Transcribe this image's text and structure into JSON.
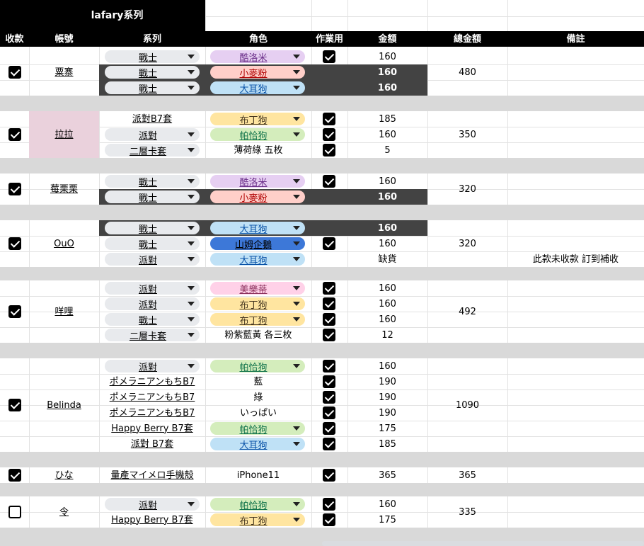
{
  "sheet": {
    "title": "lafary系列",
    "headers": {
      "paid": "收款",
      "account": "帳號",
      "series": "系列",
      "role": "角色",
      "work": "作業用",
      "amount": "金額",
      "total": "總金額",
      "note": "備註"
    },
    "colors": {
      "header_bg": "#000000",
      "separator": "#d9d9d9",
      "dark_row": "#434343",
      "pink_cell": "#ead1dc",
      "chip_grey": "#e8eaed",
      "chip_purple": "#e6cff2",
      "chip_red": "#ffcfc9",
      "chip_blue": "#bfe1f6",
      "chip_yellow": "#ffe5a0",
      "chip_green": "#d4edbc",
      "chip_pink": "#ffd1e8",
      "chip_royal": "#3d78d8"
    },
    "groups": [
      {
        "account": "粟寨",
        "paid": true,
        "total": "480",
        "account_bg": "",
        "rows": [
          {
            "series": "戰士",
            "series_chip": true,
            "role": "酷洛米",
            "role_color": "purple",
            "work": true,
            "amount": "160",
            "dark": false,
            "note": ""
          },
          {
            "series": "戰士",
            "series_chip": true,
            "role": "小麥粉",
            "role_color": "red",
            "work": false,
            "amount": "160",
            "dark": true,
            "note": ""
          },
          {
            "series": "戰士",
            "series_chip": true,
            "role": "大耳狗",
            "role_color": "blue",
            "work": false,
            "amount": "160",
            "dark": true,
            "note": ""
          }
        ]
      },
      {
        "account": "拉拉",
        "paid": true,
        "total": "350",
        "account_bg": "pink",
        "rows": [
          {
            "series": "派對B7套",
            "series_chip": false,
            "role": "布丁狗",
            "role_color": "yellow",
            "work": true,
            "amount": "185",
            "dark": false,
            "note": ""
          },
          {
            "series": "派對",
            "series_chip": true,
            "role": "帕恰狗",
            "role_color": "green",
            "work": true,
            "amount": "160",
            "dark": false,
            "note": ""
          },
          {
            "series": "二層卡套",
            "series_chip": true,
            "role": "薄荷綠 五枚",
            "role_color": "",
            "work": true,
            "amount": "5",
            "dark": false,
            "note": ""
          }
        ]
      },
      {
        "account": "莓栗栗",
        "paid": true,
        "total": "320",
        "account_bg": "",
        "rows": [
          {
            "series": "戰士",
            "series_chip": true,
            "role": "酷洛米",
            "role_color": "purple",
            "work": true,
            "amount": "160",
            "dark": false,
            "note": ""
          },
          {
            "series": "戰士",
            "series_chip": true,
            "role": "小麥粉",
            "role_color": "red",
            "work": false,
            "amount": "160",
            "dark": true,
            "note": ""
          }
        ]
      },
      {
        "account": "OuO",
        "paid": true,
        "total": "320",
        "account_bg": "",
        "rows": [
          {
            "series": "戰士",
            "series_chip": true,
            "role": "大耳狗",
            "role_color": "blue",
            "work": false,
            "amount": "160",
            "dark": true,
            "note": ""
          },
          {
            "series": "戰士",
            "series_chip": true,
            "role": "山姆企鵝",
            "role_color": "royal",
            "work": true,
            "amount": "160",
            "dark": false,
            "note": ""
          },
          {
            "series": "派對",
            "series_chip": true,
            "role": "大耳狗",
            "role_color": "blue",
            "work": false,
            "amount": "缺貨",
            "dark": false,
            "note": "此款未收款 訂到補收"
          }
        ]
      },
      {
        "account": "咩哩",
        "paid": true,
        "total": "492",
        "account_bg": "",
        "rows": [
          {
            "series": "派對",
            "series_chip": true,
            "role": "美樂蒂",
            "role_color": "pink",
            "work": true,
            "amount": "160",
            "dark": false,
            "note": ""
          },
          {
            "series": "派對",
            "series_chip": true,
            "role": "布丁狗",
            "role_color": "yellow",
            "work": true,
            "amount": "160",
            "dark": false,
            "note": ""
          },
          {
            "series": "戰士",
            "series_chip": true,
            "role": "布丁狗",
            "role_color": "yellow",
            "work": true,
            "amount": "160",
            "dark": false,
            "note": ""
          },
          {
            "series": "二層卡套",
            "series_chip": true,
            "role": "粉紫藍黃 各三枚",
            "role_color": "",
            "work": true,
            "amount": "12",
            "dark": false,
            "note": ""
          }
        ]
      },
      {
        "account": "Belinda",
        "paid": true,
        "total": "1090",
        "account_bg": "",
        "rows": [
          {
            "series": "派對",
            "series_chip": true,
            "role": "帕恰狗",
            "role_color": "green",
            "work": true,
            "amount": "160",
            "dark": false,
            "note": ""
          },
          {
            "series": "ポメラニアンもちB7",
            "series_chip": false,
            "role": "藍",
            "role_color": "",
            "work": true,
            "amount": "190",
            "dark": false,
            "note": ""
          },
          {
            "series": "ポメラニアンもちB7",
            "series_chip": false,
            "role": "綠",
            "role_color": "",
            "work": true,
            "amount": "190",
            "dark": false,
            "note": ""
          },
          {
            "series": "ポメラニアンもちB7",
            "series_chip": false,
            "role": "いっぱい",
            "role_color": "",
            "work": true,
            "amount": "190",
            "dark": false,
            "note": ""
          },
          {
            "series": "Happy Berry B7套",
            "series_chip": false,
            "role": "帕恰狗",
            "role_color": "green",
            "work": true,
            "amount": "175",
            "dark": false,
            "note": ""
          },
          {
            "series": "派對 B7套",
            "series_chip": false,
            "role": "大耳狗",
            "role_color": "blue",
            "work": true,
            "amount": "185",
            "dark": false,
            "note": ""
          }
        ]
      },
      {
        "account": "ひな",
        "paid": true,
        "total": "365",
        "account_bg": "",
        "rows": [
          {
            "series": "量產マイメロ手機殼",
            "series_chip": false,
            "role": "iPhone11",
            "role_color": "",
            "work": true,
            "amount": "365",
            "dark": false,
            "note": ""
          }
        ]
      },
      {
        "account": "令",
        "paid": false,
        "total": "335",
        "account_bg": "",
        "rows": [
          {
            "series": "派對",
            "series_chip": true,
            "role": "帕恰狗",
            "role_color": "green",
            "work": true,
            "amount": "160",
            "dark": false,
            "note": ""
          },
          {
            "series": "Happy Berry B7套",
            "series_chip": false,
            "role": "布丁狗",
            "role_color": "yellow",
            "work": true,
            "amount": "175",
            "dark": false,
            "note": ""
          }
        ]
      }
    ]
  }
}
